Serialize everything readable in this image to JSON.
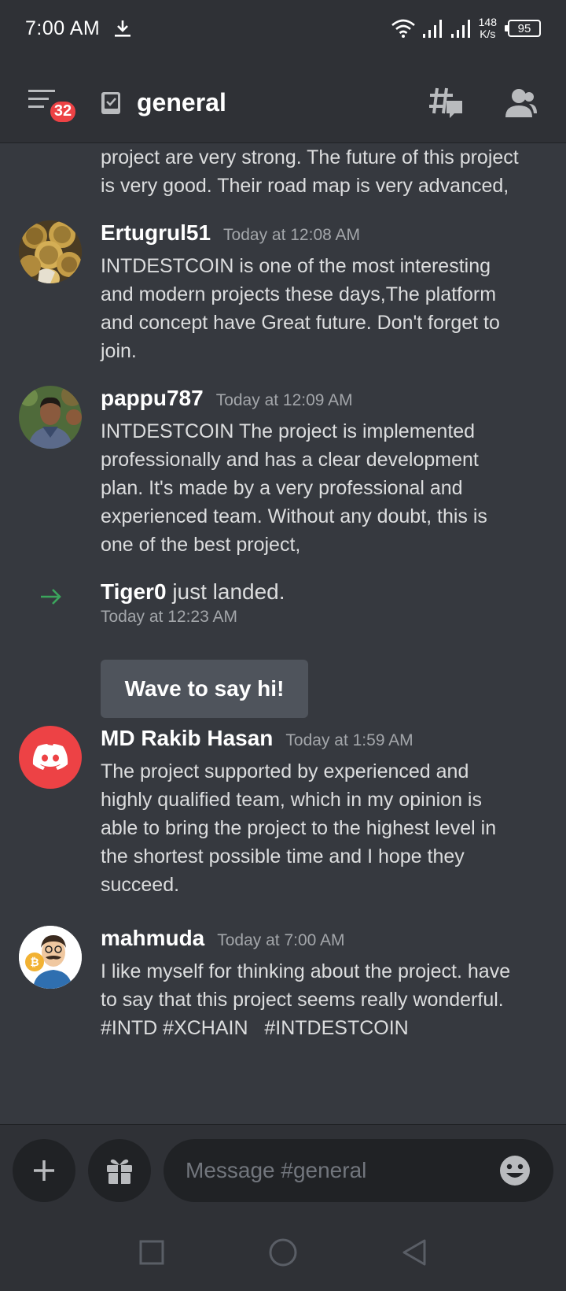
{
  "status_bar": {
    "time": "7:00 AM",
    "net_speed_value": "148",
    "net_speed_unit": "K/s",
    "battery": "95"
  },
  "header": {
    "badge_count": "32",
    "channel_name": "general",
    "icons": [
      "menu-icon",
      "channel-icon",
      "threads-icon",
      "members-icon"
    ]
  },
  "messages": [
    {
      "type": "continuation",
      "lines": [
        "project are very strong. The future of this project",
        "is very good. Their road map is very advanced,"
      ]
    },
    {
      "type": "message",
      "username": "Ertugrul51",
      "timestamp": "Today at 12:08 AM",
      "lines": [
        "INTDESTCOIN is one of the most interesting",
        "and modern projects these days,The platform",
        "and concept have Great future. Don't forget to",
        "join."
      ]
    },
    {
      "type": "message",
      "username": "pappu787",
      "timestamp": "Today at 12:09 AM",
      "lines": [
        "INTDESTCOIN The project is implemented",
        "professionally and has a clear development",
        "plan. It's made by a very professional and",
        "experienced team. Without any doubt, this is",
        "one of the best project,"
      ]
    },
    {
      "type": "join",
      "username": "Tiger0",
      "action": "just landed.",
      "timestamp": "Today at 12:23 AM",
      "button_label": "Wave to say hi!"
    },
    {
      "type": "message",
      "username": "MD Rakib Hasan",
      "timestamp": "Today at 1:59 AM",
      "lines": [
        "The project supported by experienced and",
        "highly qualified team, which in my opinion is",
        "able to bring the project to the highest level in",
        "the shortest possible time and I hope they",
        "succeed."
      ]
    },
    {
      "type": "message",
      "username": "mahmuda",
      "timestamp": "Today at 7:00 AM",
      "lines": [
        "I like myself for thinking about the project. have",
        "to say that this project seems really wonderful.",
        "#INTD #XCHAIN   #INTDESTCOIN"
      ]
    }
  ],
  "composer": {
    "placeholder": "Message #general"
  },
  "colors": {
    "background": "#36393f",
    "header_bg": "#2f3136",
    "badge": "#ed4245",
    "discord_red": "#ed4245",
    "join_arrow": "#3ba55c"
  }
}
